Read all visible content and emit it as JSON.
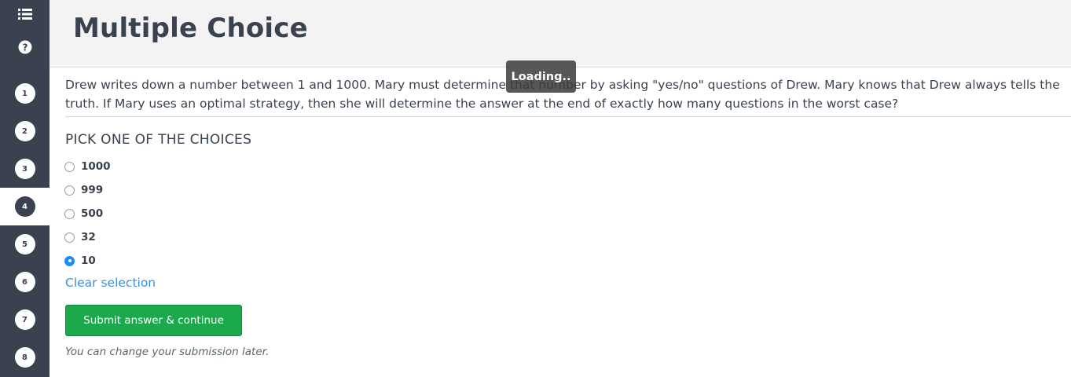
{
  "sidebar": {
    "icons": [
      {
        "name": "list-icon"
      },
      {
        "name": "help-icon"
      }
    ],
    "questions": [
      {
        "label": "1",
        "active": false
      },
      {
        "label": "2",
        "active": false
      },
      {
        "label": "3",
        "active": false
      },
      {
        "label": "4",
        "active": true
      },
      {
        "label": "5",
        "active": false
      },
      {
        "label": "6",
        "active": false
      },
      {
        "label": "7",
        "active": false
      },
      {
        "label": "8",
        "active": false
      }
    ]
  },
  "header": {
    "title": "Multiple Choice"
  },
  "question": {
    "text": "Drew writes down a number between 1 and 1000. Mary must determine that number by asking \"yes/no\" questions of Drew. Mary knows that Drew always tells the truth. If Mary uses an optimal strategy, then she will determine the answer at the end of exactly how many questions in the worst case?"
  },
  "choices": {
    "heading": "PICK ONE OF THE CHOICES",
    "options": [
      {
        "label": "1000",
        "selected": false
      },
      {
        "label": "999",
        "selected": false
      },
      {
        "label": "500",
        "selected": false
      },
      {
        "label": "32",
        "selected": false
      },
      {
        "label": "10",
        "selected": true
      }
    ],
    "clear_label": "Clear selection"
  },
  "actions": {
    "submit_label": "Submit answer & continue",
    "note": "You can change your submission later."
  },
  "overlay": {
    "loading_text": "Loading.."
  },
  "colors": {
    "sidebar_bg": "#39424e",
    "submit_green": "#1ba94c",
    "link_blue": "#3b8fd9",
    "radio_selected": "#1d8cf8"
  }
}
